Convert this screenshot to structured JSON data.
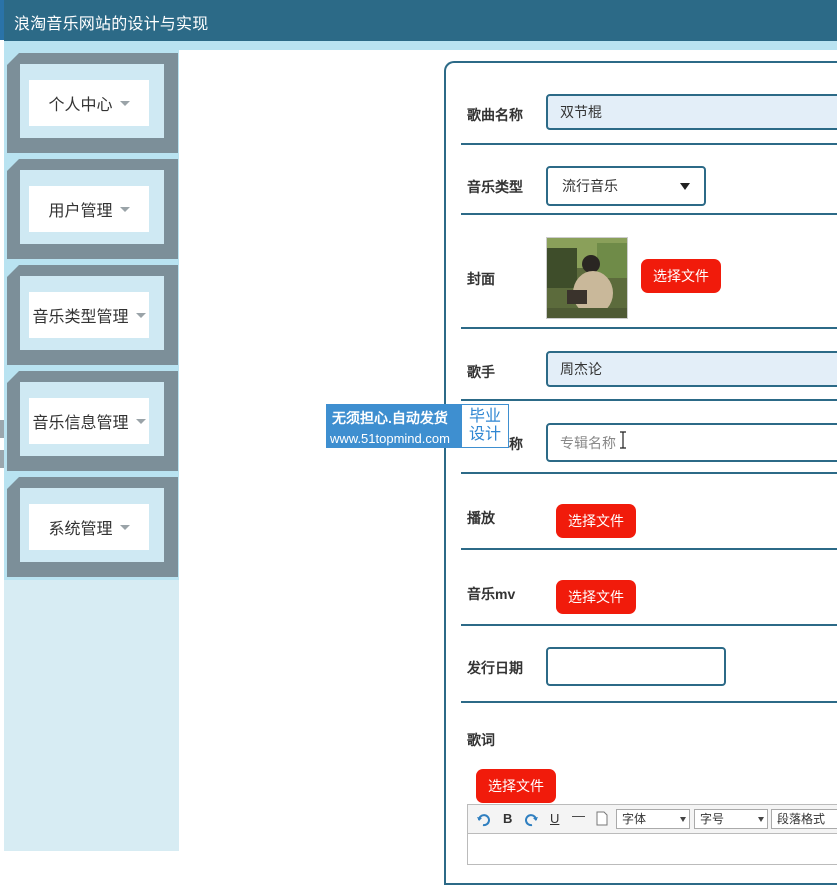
{
  "header": {
    "title": "浪淘音乐网站的设计与实现"
  },
  "sidebar": {
    "items": [
      {
        "label": "个人中心"
      },
      {
        "label": "用户管理"
      },
      {
        "label": "音乐类型管理"
      },
      {
        "label": "音乐信息管理"
      },
      {
        "label": "系统管理"
      }
    ]
  },
  "form": {
    "song_name": {
      "label": "歌曲名称",
      "value": "双节棍"
    },
    "music_type": {
      "label": "音乐类型",
      "value": "流行音乐"
    },
    "cover": {
      "label": "封面",
      "button": "选择文件"
    },
    "singer": {
      "label": "歌手",
      "value": "周杰论"
    },
    "album": {
      "label_visible": "称",
      "placeholder": "专辑名称"
    },
    "play": {
      "label": "播放",
      "button": "选择文件"
    },
    "mv": {
      "label": "音乐mv",
      "button": "选择文件"
    },
    "release_date": {
      "label": "发行日期",
      "value": ""
    },
    "lyrics": {
      "label": "歌词",
      "button": "选择文件"
    }
  },
  "editor_toolbar": {
    "bold": "B",
    "underline": "U",
    "font_family": "字体",
    "font_size": "字号",
    "paragraph": "段落格式"
  },
  "watermark": {
    "line1": "无须担心.自动发货",
    "url": "www.51topmind.com",
    "badge_line1": "毕业",
    "badge_line2": "设计"
  },
  "colors": {
    "header": "#2c6a87",
    "accent_button": "#f11b0b",
    "sidebar_light": "#b9e3f1",
    "sidebar_dark": "#7c8f99"
  }
}
